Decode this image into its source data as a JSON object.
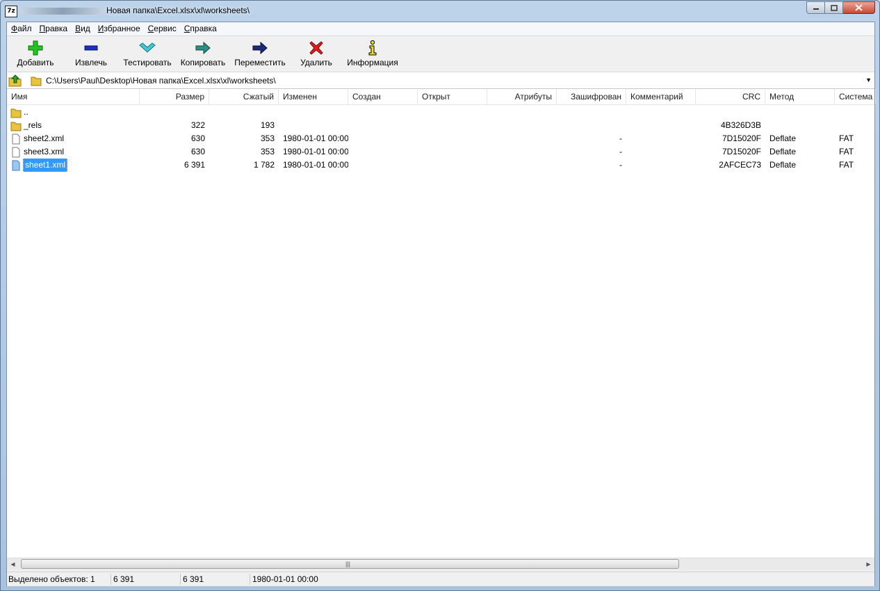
{
  "window": {
    "title": "Новая папка\\Excel.xlsx\\xl\\worksheets\\",
    "app_icon_text": "7z"
  },
  "menu": [
    "Файл",
    "Правка",
    "Вид",
    "Избранное",
    "Сервис",
    "Справка"
  ],
  "toolbar": {
    "add": "Добавить",
    "extract": "Извлечь",
    "test": "Тестировать",
    "copy": "Копировать",
    "move": "Переместить",
    "delete": "Удалить",
    "info": "Информация"
  },
  "address": {
    "path": "C:\\Users\\Paul\\Desktop\\Новая папка\\Excel.xlsx\\xl\\worksheets\\"
  },
  "columns": [
    "Имя",
    "Размер",
    "Сжатый",
    "Изменен",
    "Создан",
    "Открыт",
    "Атрибуты",
    "Зашифрован",
    "Комментарий",
    "CRC",
    "Метод",
    "Система"
  ],
  "rows": [
    {
      "type": "folder",
      "name": "..",
      "size": "",
      "packed": "",
      "modified": "",
      "created": "",
      "opened": "",
      "attributes": "",
      "encrypted": "",
      "comment": "",
      "crc": "",
      "method": "",
      "system": ""
    },
    {
      "type": "folder",
      "name": "_rels",
      "size": "322",
      "packed": "193",
      "modified": "",
      "created": "",
      "opened": "",
      "attributes": "",
      "encrypted": "",
      "comment": "",
      "crc": "4B326D3B",
      "method": "",
      "system": ""
    },
    {
      "type": "file",
      "name": "sheet2.xml",
      "size": "630",
      "packed": "353",
      "modified": "1980-01-01 00:00",
      "created": "",
      "opened": "",
      "attributes": "",
      "encrypted": "-",
      "comment": "",
      "crc": "7D15020F",
      "method": "Deflate",
      "system": "FAT"
    },
    {
      "type": "file",
      "name": "sheet3.xml",
      "size": "630",
      "packed": "353",
      "modified": "1980-01-01 00:00",
      "created": "",
      "opened": "",
      "attributes": "",
      "encrypted": "-",
      "comment": "",
      "crc": "7D15020F",
      "method": "Deflate",
      "system": "FAT"
    },
    {
      "type": "file",
      "name": "sheet1.xml",
      "size": "6 391",
      "packed": "1 782",
      "modified": "1980-01-01 00:00",
      "created": "",
      "opened": "",
      "attributes": "",
      "encrypted": "-",
      "comment": "",
      "crc": "2AFCEC73",
      "method": "Deflate",
      "system": "FAT",
      "selected": true
    }
  ],
  "status": {
    "selected": "Выделено объектов: 1",
    "size": "6 391",
    "packed": "6 391",
    "modified": "1980-01-01 00:00"
  },
  "colors": {
    "selection": "#3399ff",
    "add_icon": "#22c322",
    "extract_icon": "#1a2fc9",
    "test_icon": "#3fc9d6",
    "copy_icon": "#2a8f86",
    "move_icon": "#1b2a7a",
    "delete_icon": "#e01e1e",
    "info_icon": "#f0e21a"
  },
  "icons": {
    "add": "plus-icon",
    "extract": "minus-icon",
    "test": "checkmark-icon",
    "copy": "arrow-right-icon",
    "move": "arrow-right-icon",
    "delete": "cross-icon",
    "info": "info-icon",
    "up": "folder-up-icon",
    "folder": "folder-icon",
    "file": "file-icon"
  }
}
